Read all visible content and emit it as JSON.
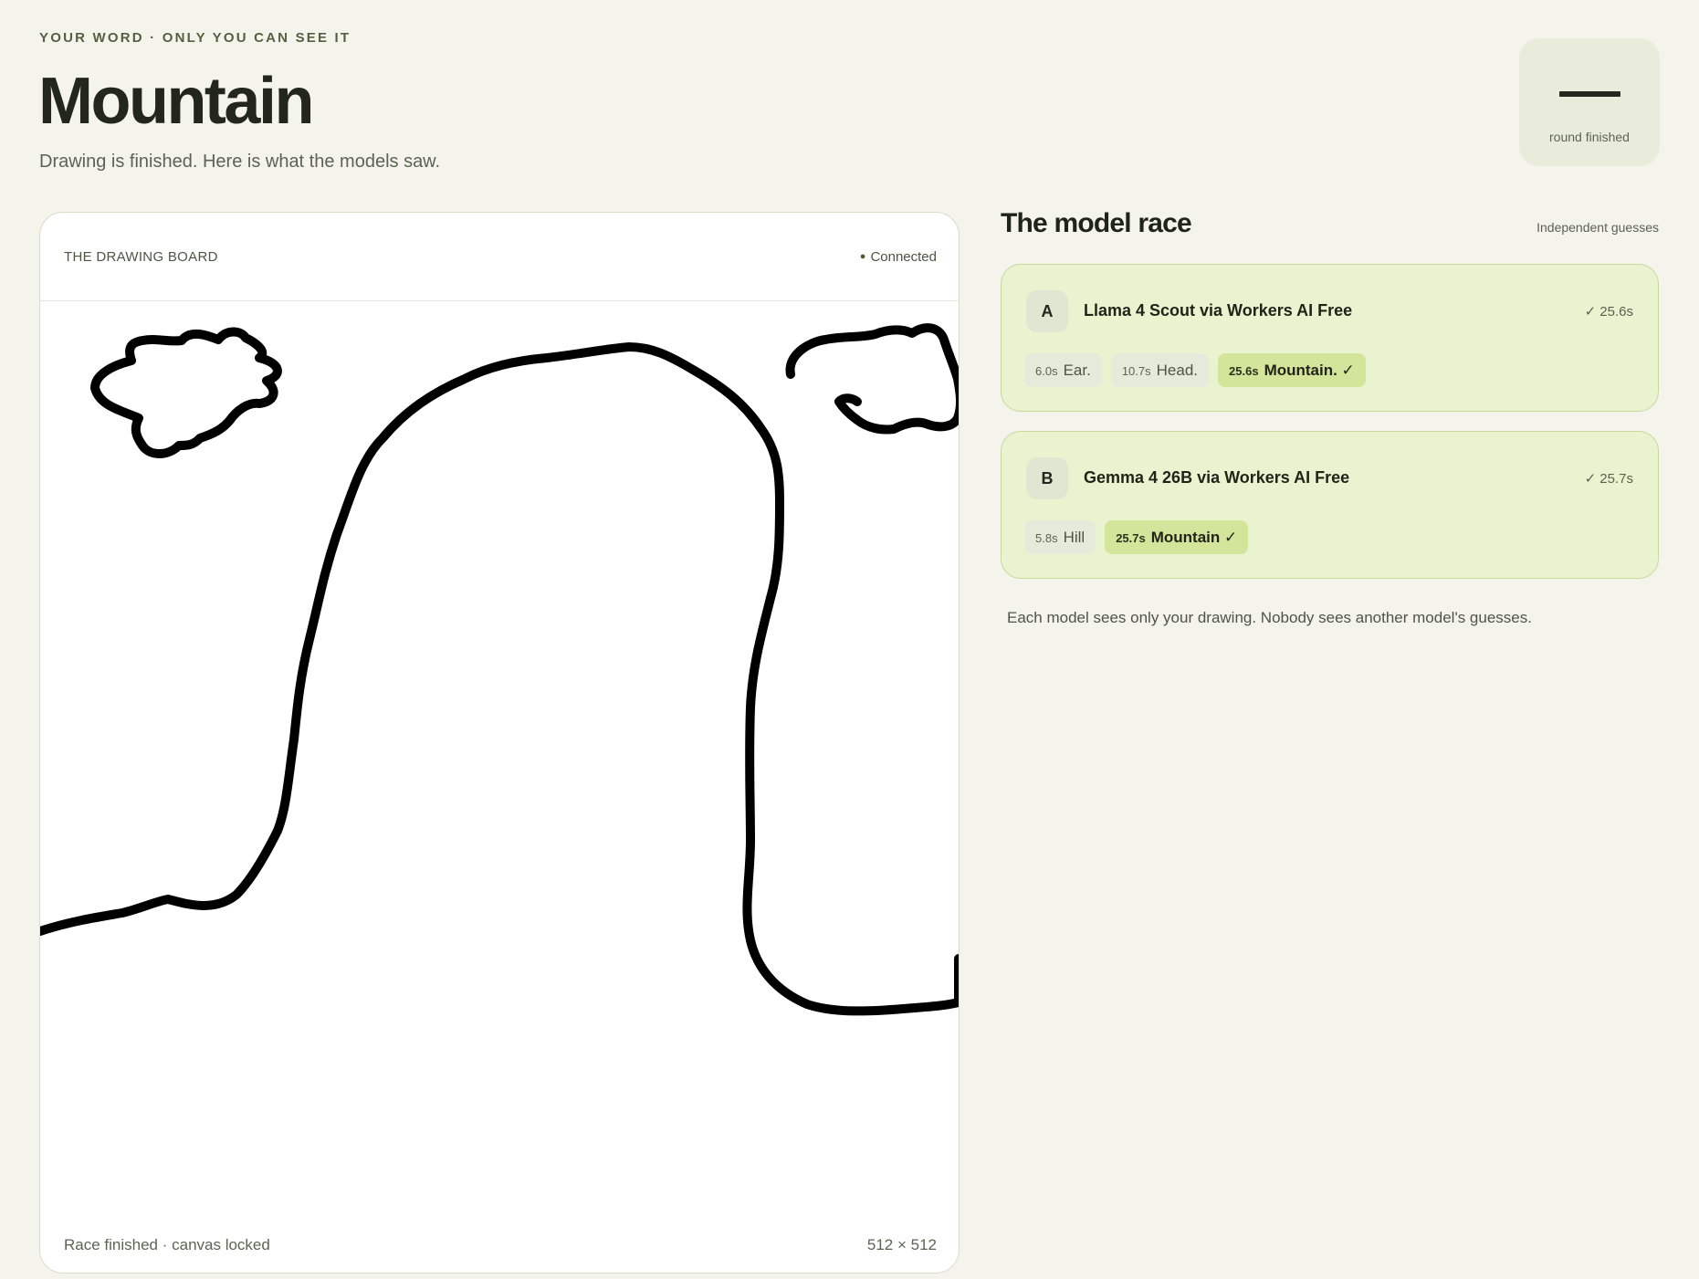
{
  "header": {
    "eyebrow": "YOUR WORD · ONLY YOU CAN SEE IT",
    "word": "Mountain",
    "subtitle": "Drawing is finished. Here is what the models saw."
  },
  "timer": {
    "value": "—",
    "label": "round finished"
  },
  "board": {
    "title": "THE DRAWING BOARD",
    "status": "Connected",
    "footer_left": "Race finished · canvas locked",
    "footer_right": "512 × 512"
  },
  "race": {
    "title": "The model race",
    "note": "Independent guesses",
    "footnote": "Each model sees only your drawing. Nobody sees another model's guesses.",
    "models": [
      {
        "letter": "A",
        "name": "Llama 4 Scout via Workers AI Free",
        "result": "✓ 25.6s",
        "guesses": [
          {
            "time": "6.0s",
            "word": "Ear.",
            "correct": false
          },
          {
            "time": "10.7s",
            "word": "Head.",
            "correct": false
          },
          {
            "time": "25.6s",
            "word": "Mountain. ✓",
            "correct": true
          }
        ]
      },
      {
        "letter": "B",
        "name": "Gemma 4 26B via Workers AI Free",
        "result": "✓ 25.7s",
        "guesses": [
          {
            "time": "5.8s",
            "word": "Hill",
            "correct": false
          },
          {
            "time": "25.7s",
            "word": "Mountain ✓",
            "correct": true
          }
        ]
      }
    ]
  },
  "colors": {
    "background": "#f4f4ec",
    "card": "#eaf3cf",
    "card_border": "#c7d89a",
    "correct_chip": "#d2e59a",
    "ink": "#000000"
  }
}
